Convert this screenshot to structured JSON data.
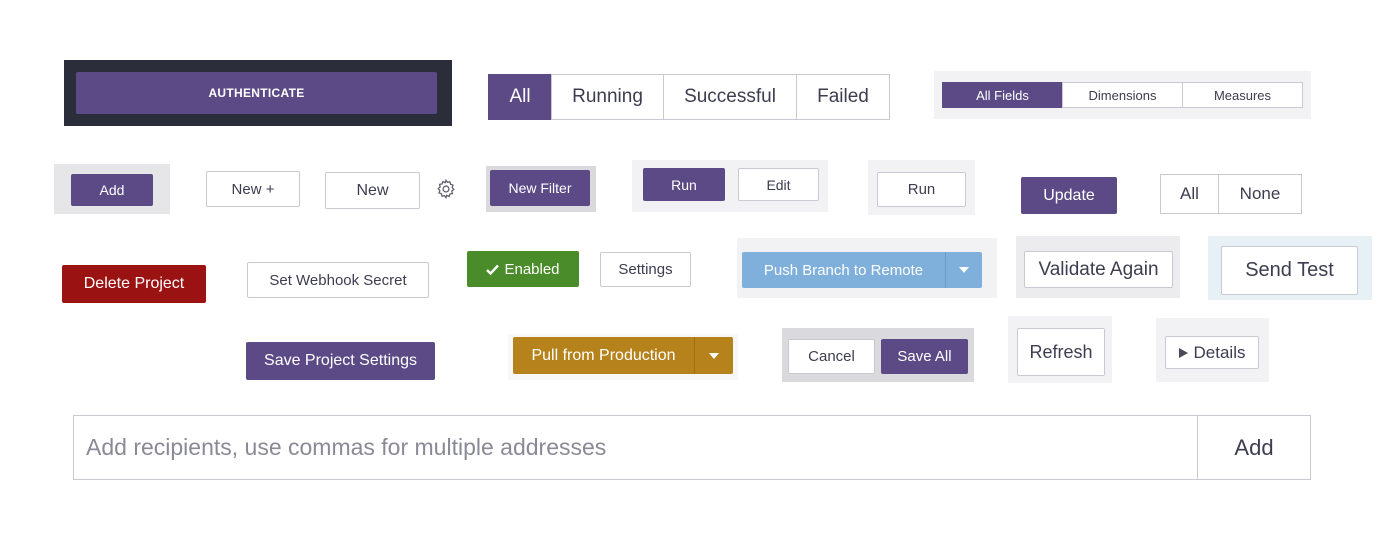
{
  "row1": {
    "authenticate_label": "AUTHENTICATE",
    "status_filter": [
      "All",
      "Running",
      "Successful",
      "Failed"
    ],
    "status_filter_active": "All",
    "field_filter": [
      "All Fields",
      "Dimensions",
      "Measures"
    ],
    "field_filter_active": "All Fields"
  },
  "row2": {
    "add_label": "Add",
    "new_plus_label": "New +",
    "new_label": "New",
    "new_filter_label": "New Filter",
    "run_label": "Run",
    "edit_label": "Edit",
    "run_outline_label": "Run",
    "update_label": "Update",
    "all_label": "All",
    "none_label": "None"
  },
  "row3": {
    "delete_project_label": "Delete Project",
    "set_webhook_secret_label": "Set Webhook Secret",
    "enabled_label": "Enabled",
    "settings_label": "Settings",
    "push_branch_label": "Push Branch to Remote",
    "validate_again_label": "Validate Again",
    "send_test_label": "Send Test"
  },
  "row4": {
    "save_project_settings_label": "Save Project Settings",
    "pull_from_production_label": "Pull from Production",
    "cancel_label": "Cancel",
    "save_all_label": "Save All",
    "refresh_label": "Refresh",
    "details_label": "Details"
  },
  "recipients": {
    "placeholder": "Add recipients, use commas for multiple addresses",
    "value": "",
    "add_label": "Add"
  },
  "colors": {
    "purple": "#5b4a86",
    "dark_frame": "#2b2d3b",
    "red": "#9b1212",
    "green": "#4a8b2a",
    "light_blue": "#7fb0dc",
    "gold": "#b5821b"
  },
  "icons": {
    "gear": "gear-icon",
    "check": "check-icon",
    "caret": "caret-down-icon",
    "play": "play-triangle-icon"
  }
}
